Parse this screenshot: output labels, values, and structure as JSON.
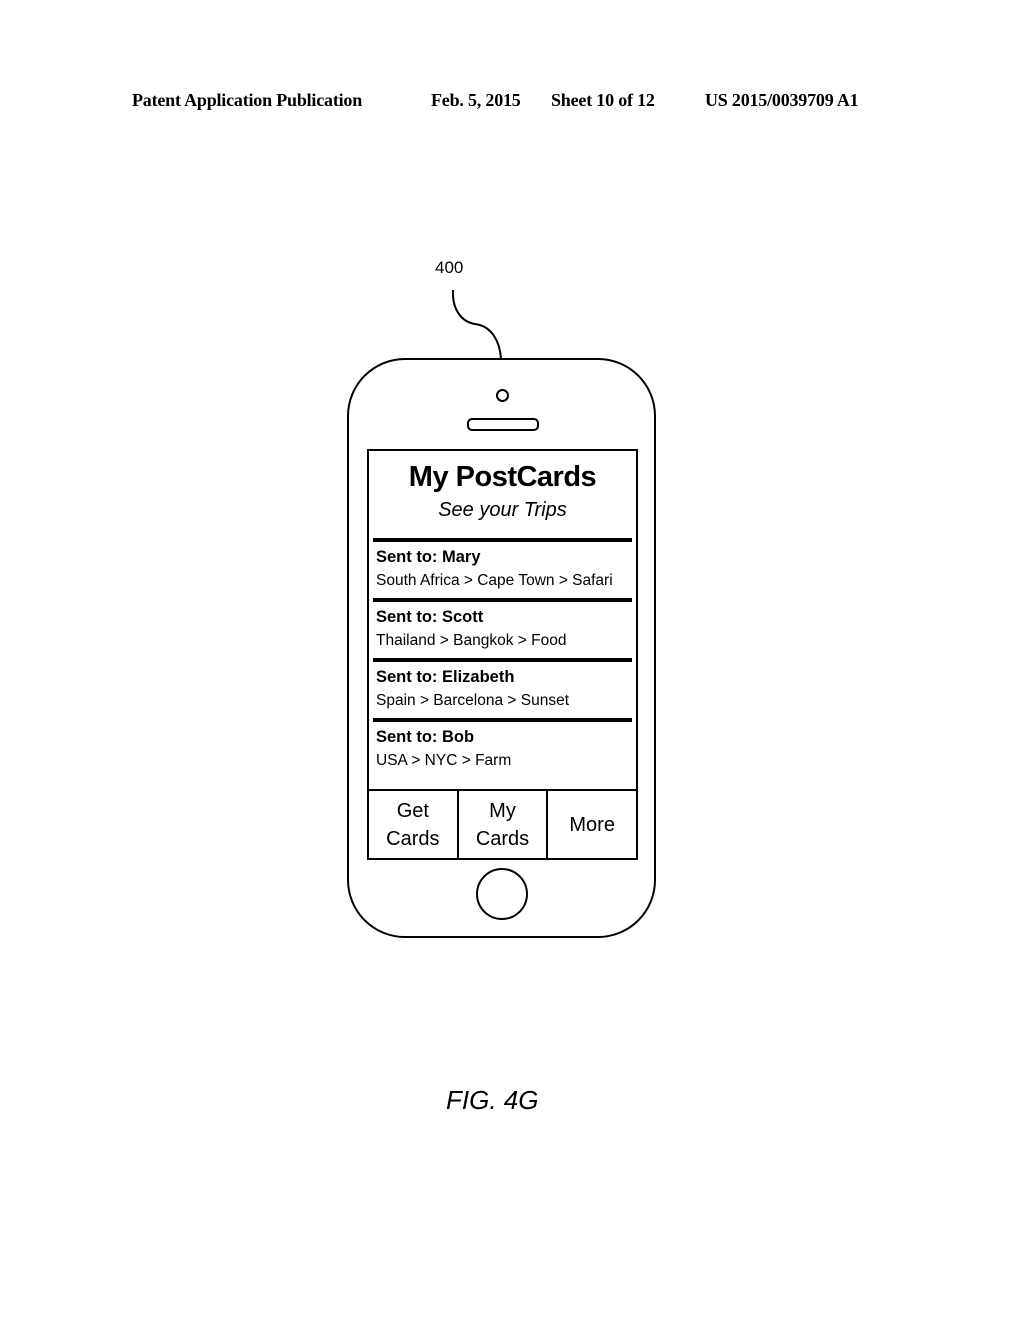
{
  "header": {
    "publication": "Patent Application Publication",
    "date": "Feb. 5, 2015",
    "sheet": "Sheet 10 of 12",
    "number": "US 2015/0039709 A1"
  },
  "figure": {
    "reference_numeral": "400",
    "caption": "FIG. 4G"
  },
  "app": {
    "title": "My PostCards",
    "subtitle": "See your Trips",
    "items": [
      {
        "name": "Sent to: Mary",
        "path": "South Africa > Cape Town > Safari"
      },
      {
        "name": "Sent to: Scott",
        "path": "Thailand > Bangkok > Food"
      },
      {
        "name": "Sent to: Elizabeth",
        "path": "Spain > Barcelona > Sunset"
      },
      {
        "name": "Sent to: Bob",
        "path": "USA > NYC > Farm"
      }
    ],
    "tabs": [
      {
        "line1": "Get",
        "line2": "Cards"
      },
      {
        "line1": "My",
        "line2": "Cards"
      },
      {
        "line1": "More",
        "line2": ""
      }
    ]
  }
}
